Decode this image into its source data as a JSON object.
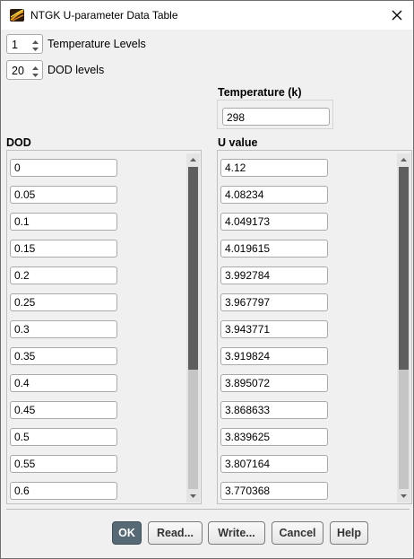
{
  "window": {
    "title": "NTGK U-parameter Data Table",
    "icon": "fluent-app-icon",
    "close_icon": "close-icon"
  },
  "temperature_levels": {
    "value": "1",
    "label": "Temperature Levels"
  },
  "dod_levels": {
    "value": "20",
    "label": "DOD levels"
  },
  "temperature": {
    "header": "Temperature (k)",
    "value": "298"
  },
  "dod": {
    "header": "DOD",
    "values": [
      "0",
      "0.05",
      "0.1",
      "0.15",
      "0.2",
      "0.25",
      "0.3",
      "0.35",
      "0.4",
      "0.45",
      "0.5",
      "0.55",
      "0.6"
    ]
  },
  "u_value": {
    "header": "U value",
    "values": [
      "4.12",
      "4.08234",
      "4.049173",
      "4.019615",
      "3.992784",
      "3.967797",
      "3.943771",
      "3.919824",
      "3.895072",
      "3.868633",
      "3.839625",
      "3.807164",
      "3.770368"
    ]
  },
  "buttons": {
    "ok": "OK",
    "read": "Read...",
    "write": "Write...",
    "cancel": "Cancel",
    "help": "Help"
  },
  "colors": {
    "primary_button": "#576975",
    "scroll_thumb": "#5e5e5e",
    "dialog_bg": "#f0f0f0"
  }
}
